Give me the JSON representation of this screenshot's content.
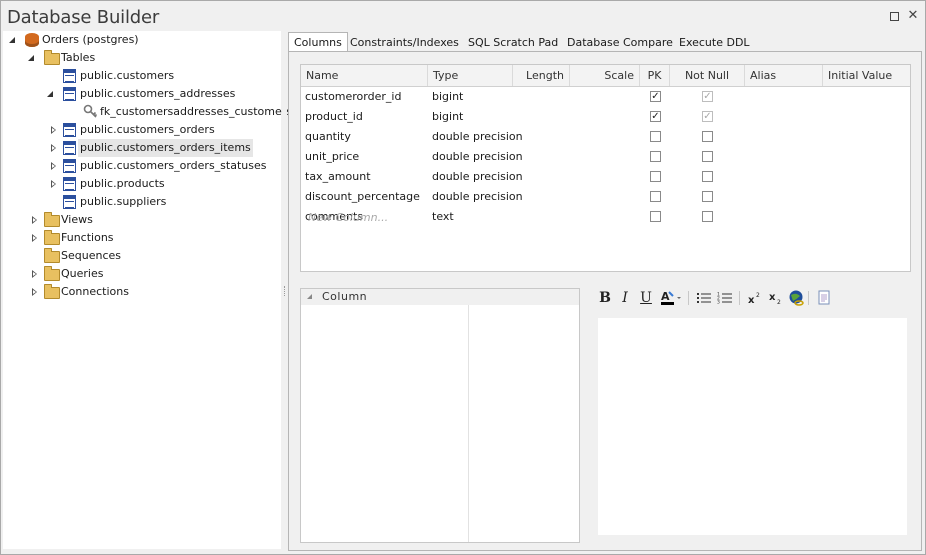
{
  "window": {
    "title": "Database Builder"
  },
  "tree": {
    "root": "Orders (postgres)",
    "tables_folder": "Tables",
    "tables": [
      "public.customers",
      "public.customers_addresses",
      "fk_customersaddresses_customers",
      "public.customers_orders",
      "public.customers_orders_items",
      "public.customers_orders_statuses",
      "public.products",
      "public.suppliers"
    ],
    "folders": [
      "Views",
      "Functions",
      "Sequences",
      "Queries",
      "Connections"
    ]
  },
  "tabs": [
    "Columns",
    "Constraints/Indexes",
    "SQL Scratch Pad",
    "Database Compare",
    "Execute DDL"
  ],
  "columns_grid": {
    "headers": [
      "Name",
      "Type",
      "Length",
      "Scale",
      "PK",
      "Not Null",
      "Alias",
      "Initial Value"
    ],
    "rows": [
      {
        "name": "customerorder_id",
        "type": "bigint",
        "pk": true,
        "notnull": true
      },
      {
        "name": "product_id",
        "type": "bigint",
        "pk": true,
        "notnull": true
      },
      {
        "name": "quantity",
        "type": "double precision",
        "pk": false,
        "notnull": false
      },
      {
        "name": "unit_price",
        "type": "double precision",
        "pk": false,
        "notnull": false
      },
      {
        "name": "tax_amount",
        "type": "double precision",
        "pk": false,
        "notnull": false
      },
      {
        "name": "discount_percentage",
        "type": "double precision",
        "pk": false,
        "notnull": false
      },
      {
        "name": "comments",
        "type": "text",
        "pk": false,
        "notnull": false
      }
    ],
    "new_row_placeholder": "New Column..."
  },
  "properties": {
    "section": "Column"
  },
  "editor_toolbar": {
    "bold": "B",
    "italic": "I",
    "underline": "U",
    "icons": [
      "bold-icon",
      "italic-icon",
      "underline-icon",
      "text-color-icon",
      "bullet-list-icon",
      "numbered-list-icon",
      "superscript-icon",
      "subscript-icon",
      "hyperlink-icon",
      "document-icon"
    ]
  },
  "colors": {
    "accent_blue": "#2b4f9e",
    "folder": "#e8c060",
    "selection": "#e6e6e6"
  }
}
